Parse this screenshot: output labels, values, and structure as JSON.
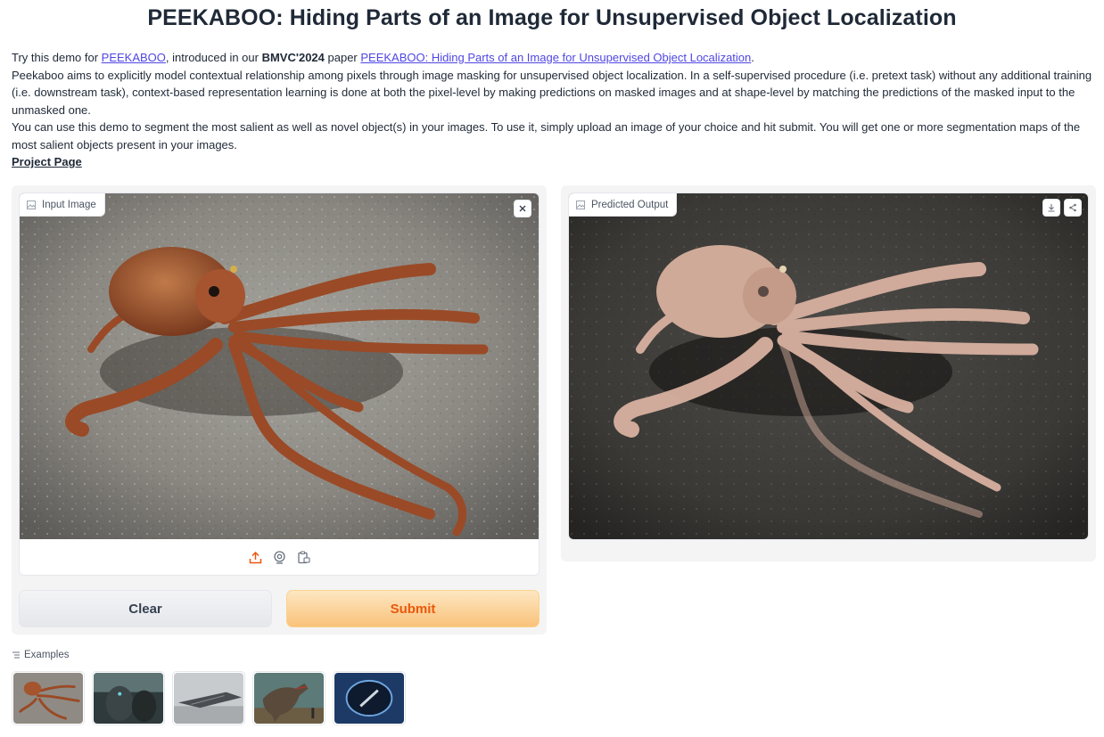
{
  "title": "PEEKABOO: Hiding Parts of an Image for Unsupervised Object Localization",
  "intro": {
    "line1_prefix": "Try this demo for ",
    "line1_link": "PEEKABOO",
    "line1_mid": ", introduced in our ",
    "line1_bold": "BMVC'2024",
    "line1_mid2": " paper ",
    "line1_paper_link": "PEEKABOO: Hiding Parts of an Image for Unsupervised Object Localization",
    "line1_end": ".",
    "para2": "Peekaboo aims to explicitly model contextual relationship among pixels through image masking for unsupervised object localization. In a self-supervised procedure (i.e. pretext task) without any additional training (i.e. downstream task), context-based representation learning is done at both the pixel-level by making predictions on masked images and at shape-level by matching the predictions of the masked input to the unmasked one.",
    "para3": "You can use this demo to segment the most salient as well as novel object(s) in your images. To use it, simply upload an image of your choice and hit submit. You will get one or more segmentation maps of the most salient objects present in your images.",
    "project_link": "Project Page"
  },
  "input": {
    "label": "Input Image",
    "icons": [
      "image-icon",
      "close-icon",
      "upload-icon",
      "webcam-icon",
      "clipboard-icon"
    ]
  },
  "output": {
    "label": "Predicted Output",
    "icons": [
      "image-icon",
      "download-icon",
      "share-icon"
    ]
  },
  "buttons": {
    "clear": "Clear",
    "submit": "Submit"
  },
  "examples": {
    "label": "Examples",
    "items": [
      "example-octopus",
      "example-monsters",
      "example-spaceship",
      "example-dinosaur",
      "example-portal"
    ]
  },
  "colors": {
    "accent": "#ea580c",
    "link": "#4f46e5",
    "panel_bg": "#f4f4f5"
  }
}
